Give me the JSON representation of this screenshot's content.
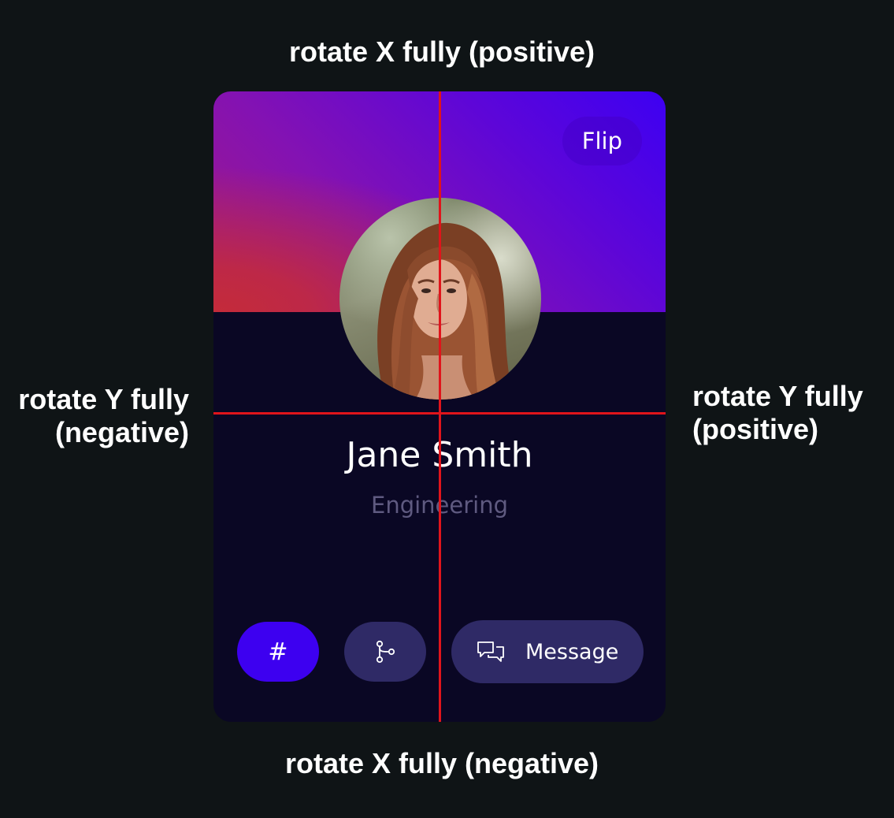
{
  "guides": {
    "top": "rotate X fully (positive)",
    "bottom": "rotate X fully (negative)",
    "left_line1": "rotate Y fully",
    "left_line2": "(negative)",
    "right_line1": "rotate Y fully",
    "right_line2": "(positive)",
    "line_color": "#e0141b"
  },
  "card": {
    "flip_label": "Flip",
    "name": "Jane Smith",
    "department": "Engineering",
    "avatar_icon": "profile-photo",
    "actions": {
      "hash_label": "#",
      "branch_icon": "git-branch-icon",
      "message_icon": "chat-bubbles-icon",
      "message_label": "Message"
    },
    "colors": {
      "background": "#0a0724",
      "accent": "#3d00f0",
      "button": "#2f2a66",
      "header_start": "#c42b3a",
      "header_end": "#3d00f2"
    }
  }
}
